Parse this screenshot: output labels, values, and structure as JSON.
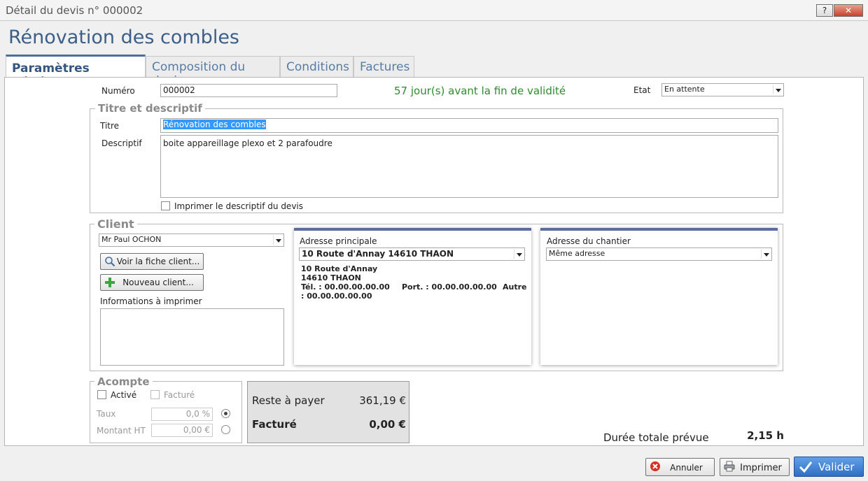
{
  "window": {
    "title": "Détail du devis n°  000002",
    "help_label": "?",
    "close_label": "✕"
  },
  "page_title": "Rénovation des combles",
  "tabs": [
    {
      "label": "Paramètres généraux",
      "active": true
    },
    {
      "label": "Composition du devis",
      "active": false
    },
    {
      "label": "Conditions",
      "active": false
    },
    {
      "label": "Factures",
      "active": false
    }
  ],
  "general": {
    "numero_label": "Numéro",
    "numero_value": "000002",
    "validity_text": "57 jour(s) avant la fin de validité",
    "validity_color": "#2e8b2e",
    "etat_label": "Etat",
    "etat_value": "En attente"
  },
  "titre_group": {
    "title": "Titre et descriptif",
    "titre_label": "Titre",
    "titre_value": "Rénovation des combles",
    "descriptif_label": "Descriptif",
    "descriptif_value": "boite appareillage plexo et 2 parafoudre",
    "print_checkbox_label": "Imprimer le descriptif du devis"
  },
  "client_group": {
    "title": "Client",
    "client_value": "Mr Paul OCHON",
    "voir_button": "Voir la fiche client...",
    "nouveau_button": "Nouveau client...",
    "infos_label": "Informations à imprimer",
    "adresse_principale": {
      "title": "Adresse principale",
      "selected": "10 Route d'Annay 14610 THAON",
      "line1": "10 Route d'Annay",
      "line2": "14610 THAON",
      "tel": "Tél. : 00.00.00.00.00",
      "port": "Port. : 00.00.00.00.00",
      "autre_label": "Autre",
      "autre_value": ": 00.00.00.00.00"
    },
    "adresse_chantier": {
      "title": "Adresse du chantier",
      "selected": "Même adresse"
    }
  },
  "acompte": {
    "title": "Acompte",
    "active_label": "Activé",
    "facture_label": "Facturé",
    "taux_label": "Taux",
    "taux_value": "0,0 %",
    "montant_label": "Montant HT",
    "montant_value": "0,00 €"
  },
  "totals": {
    "reste_label": "Reste à payer",
    "reste_value": "361,19 €",
    "facture_label": "Facturé",
    "facture_value": "0,00 €"
  },
  "duree": {
    "label": "Durée totale prévue",
    "value": "2,15 h"
  },
  "footer": {
    "annuler": "Annuler",
    "imprimer": "Imprimer",
    "valider": "Valider"
  },
  "colors": {
    "accent": "#4b6f99",
    "card_bar": "#5b6c9f",
    "valider_bg": "#3b7bd0"
  }
}
